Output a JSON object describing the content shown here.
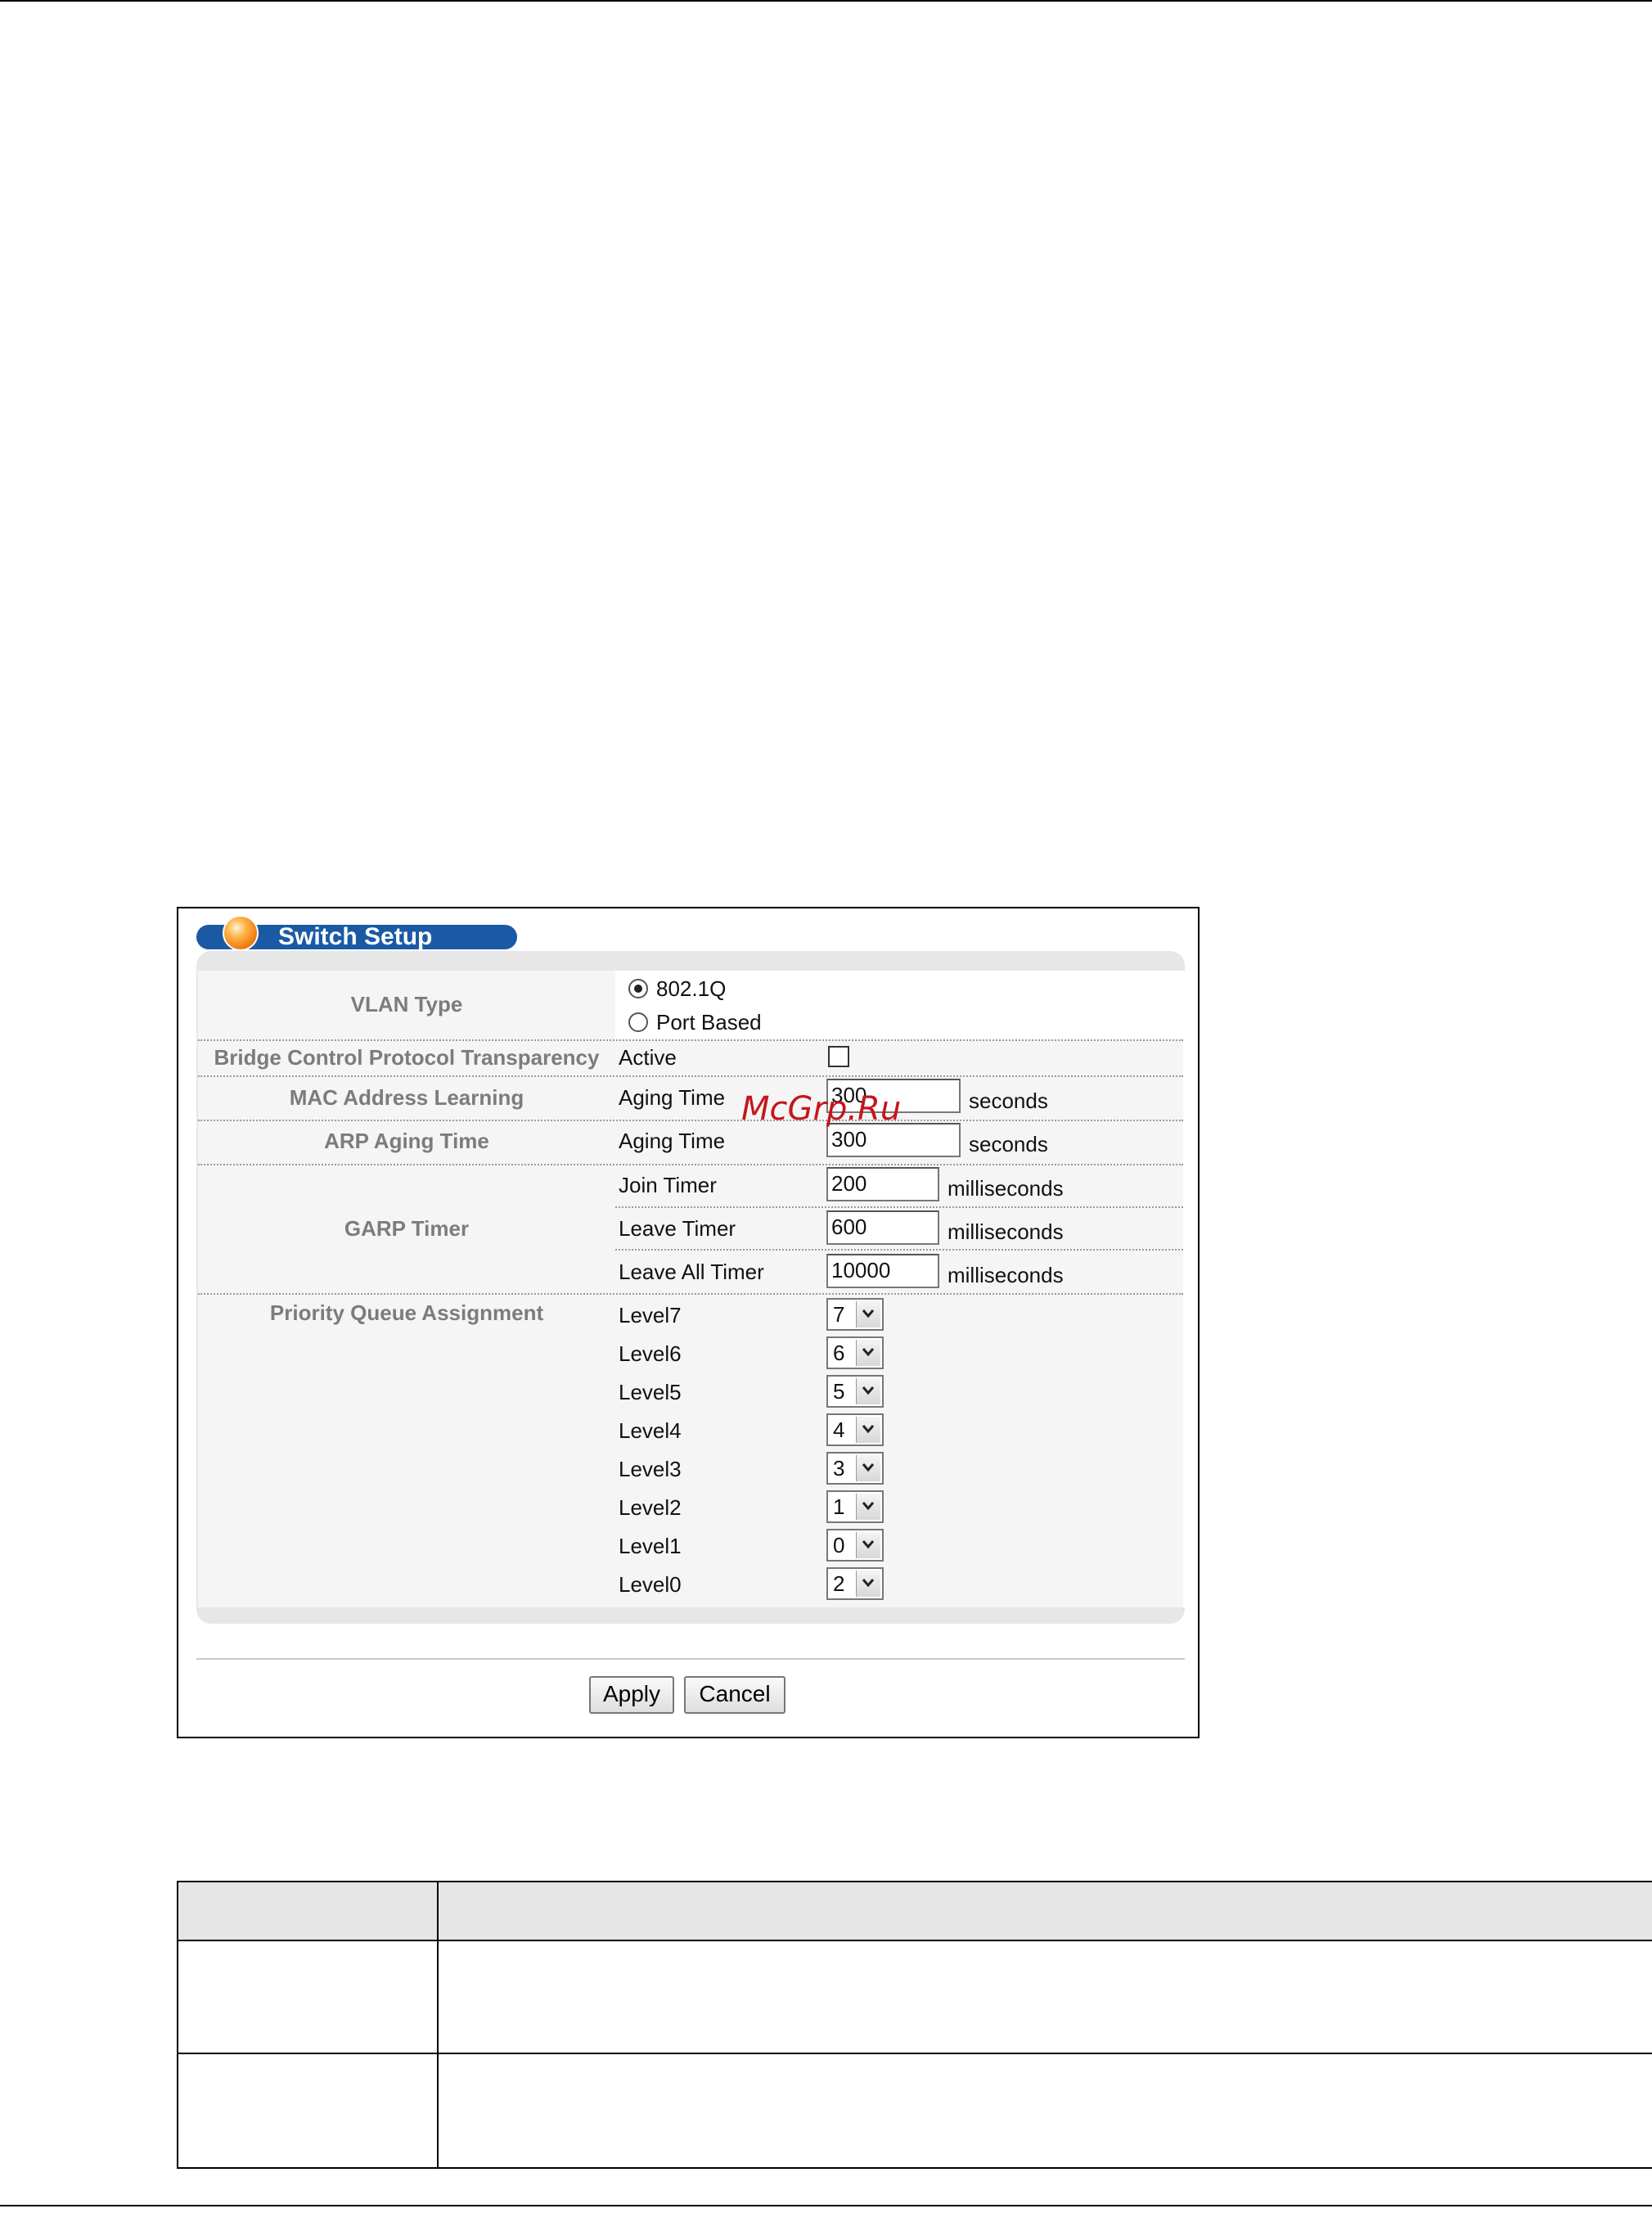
{
  "screen": {
    "title": "Switch Setup",
    "vlan_type": {
      "label": "VLAN Type",
      "options": [
        "802.1Q",
        "Port Based"
      ],
      "selected": "802.1Q"
    },
    "bcpt": {
      "label": "Bridge Control Protocol Transparency",
      "field_label": "Active",
      "checked": false
    },
    "mac_learning": {
      "label": "MAC Address Learning",
      "field_label": "Aging Time",
      "value": "300",
      "unit": "seconds"
    },
    "arp_aging": {
      "label": "ARP Aging Time",
      "field_label": "Aging Time",
      "value": "300",
      "unit": "seconds"
    },
    "garp": {
      "label": "GARP Timer",
      "join_label": "Join Timer",
      "join_value": "200",
      "leave_label": "Leave Timer",
      "leave_value": "600",
      "leave_all_label": "Leave All Timer",
      "leave_all_value": "10000",
      "unit": "milliseconds"
    },
    "priority_queue": {
      "label": "Priority Queue Assignment",
      "levels": [
        {
          "label": "Level7",
          "value": "7"
        },
        {
          "label": "Level6",
          "value": "6"
        },
        {
          "label": "Level5",
          "value": "5"
        },
        {
          "label": "Level4",
          "value": "4"
        },
        {
          "label": "Level3",
          "value": "3"
        },
        {
          "label": "Level2",
          "value": "1"
        },
        {
          "label": "Level1",
          "value": "0"
        },
        {
          "label": "Level0",
          "value": "2"
        }
      ]
    },
    "buttons": {
      "apply": "Apply",
      "cancel": "Cancel"
    }
  },
  "watermark": "McGrp.Ru",
  "colors": {
    "title_bar": "#1a5aa4",
    "orb": "#f07a12",
    "label_text": "#7c7c7c",
    "watermark": "#c4161c"
  }
}
